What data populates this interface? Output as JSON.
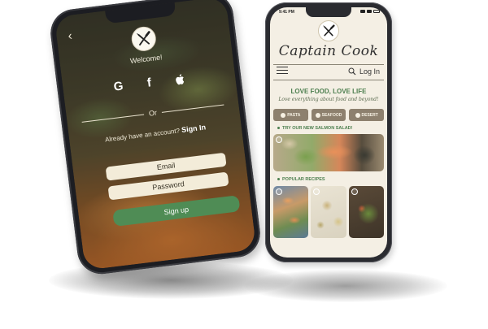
{
  "login_screen": {
    "back_icon": "back-chevron-icon",
    "logo_icon": "fork-knife-icon",
    "welcome": "Welcome!",
    "social": {
      "google": "G",
      "facebook": "f",
      "apple_icon": "apple-icon"
    },
    "or_text": "Or",
    "account_prompt": "Already have an account?",
    "sign_in": "Sign In",
    "email_field": "Email",
    "password_field": "Password",
    "signup_button": "Sign up"
  },
  "home_screen": {
    "status_time": "9:41 PM",
    "brand": "Captain Cook",
    "login_link": "Log In",
    "tagline": "LOVE FOOD, LOVE LIFE",
    "subtagline": "Love everything about food and beyond!",
    "categories": [
      {
        "label": "PASTA",
        "icon": "pasta-icon"
      },
      {
        "label": "SEAFOOD",
        "icon": "fish-icon"
      },
      {
        "label": "DESERT",
        "icon": "dessert-icon"
      }
    ],
    "featured_title": "TRY OUR NEW SALMON SALAD!",
    "popular_title": "POPULAR RECIPES"
  },
  "colors": {
    "accent_green": "#4f8c55",
    "cream": "#f4efe4",
    "category_brown": "#8d806e"
  }
}
